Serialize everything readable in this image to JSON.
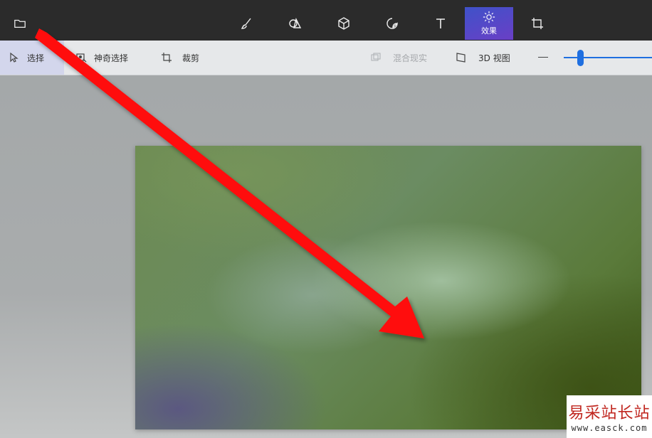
{
  "toolbar": {
    "items": [
      {
        "name": "brush-icon"
      },
      {
        "name": "2d-shapes-icon"
      },
      {
        "name": "3d-shapes-icon"
      },
      {
        "name": "stickers-icon"
      },
      {
        "name": "text-icon"
      },
      {
        "name": "effects-icon",
        "label": "效果"
      },
      {
        "name": "canvas-icon"
      }
    ],
    "active_color": "#4a4fd0"
  },
  "subbar": {
    "select_label": "选择",
    "magic_select_label": "神奇选择",
    "crop_label": "裁剪",
    "mixed_reality_label": "混合现实",
    "view3d_label": "3D 视图"
  },
  "zoom": {
    "accent": "#1f6fe0"
  },
  "watermark": {
    "cn": "易采站长站",
    "en": "www.easck.com"
  },
  "annotation": {
    "arrow_color": "#ff0000"
  }
}
